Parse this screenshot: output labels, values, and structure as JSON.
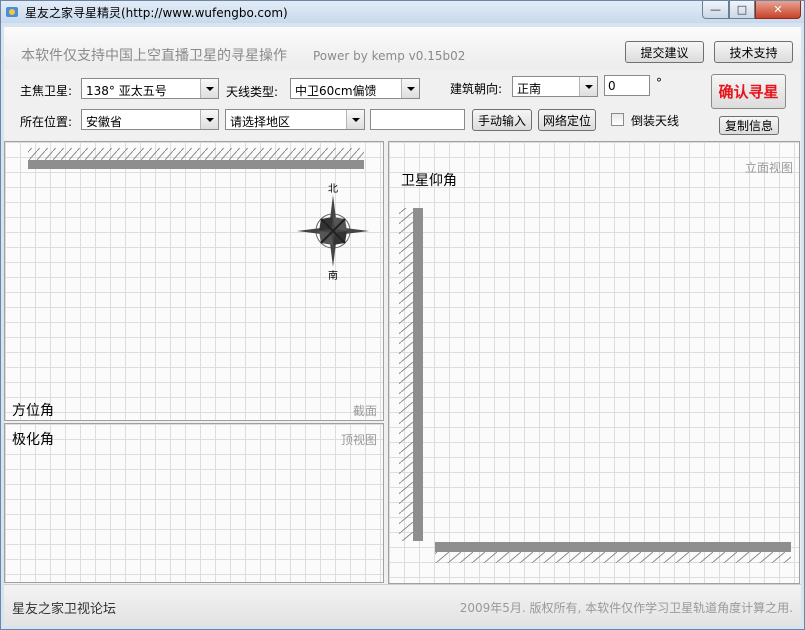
{
  "window": {
    "title": "星友之家寻星精灵(http://www.wufengbo.com)",
    "controls": {
      "minimize": "—",
      "maximize": "□",
      "close": "✕"
    }
  },
  "header": {
    "notice": "本软件仅支持中国上空直播卫星的寻星操作",
    "power": "Power by kemp  v0.15b02",
    "feedback_button": "提交建议",
    "support_button": "技术支持"
  },
  "form": {
    "satellite_label": "主焦卫星:",
    "satellite_value": "138°   亚太五号",
    "antenna_label": "天线类型:",
    "antenna_value": "中卫60cm偏馈",
    "orientation_label": "建筑朝向:",
    "orientation_value": "正南",
    "orientation_degree": "0",
    "degree_symbol": "°",
    "location_label": "所在位置:",
    "province_value": "安徽省",
    "region_value": "请选择地区",
    "region_text": "",
    "manual_button": "手动输入",
    "network_button": "网络定位",
    "inverted_label": "倒装天线",
    "inverted_checked": false,
    "confirm_button": "确认寻星",
    "copy_button": "复制信息"
  },
  "panels": {
    "azimuth": {
      "title": "方位角",
      "tag": "截面",
      "compass_north": "北",
      "compass_south": "南"
    },
    "polarization": {
      "title": "极化角",
      "tag": "顶视图"
    },
    "elevation": {
      "title": "卫星仰角",
      "tag": "立面视图"
    }
  },
  "status": {
    "forum": "星友之家卫视论坛",
    "copyright": "2009年5月. 版权所有, 本软件仅作学习卫星轨道角度计算之用."
  },
  "colors": {
    "confirm_text": "#e8141c",
    "wall": "#8e8e8e",
    "grid": "#dddddd"
  }
}
